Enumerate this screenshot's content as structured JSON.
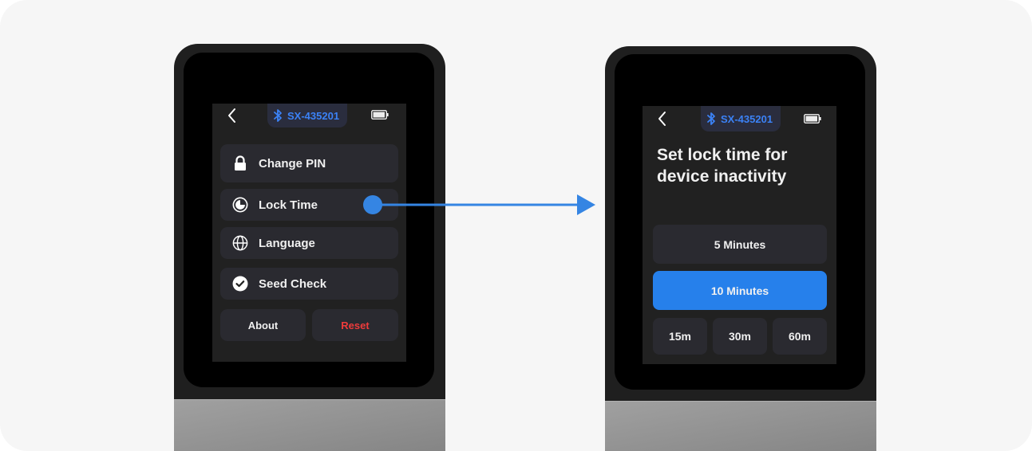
{
  "colors": {
    "accent": "#2680eb",
    "arrow": "#3585e3",
    "bluetooth_text": "#3b82f6",
    "danger": "#ef3b3b",
    "screen_bg": "#212121",
    "tile_bg": "#2a2a30"
  },
  "left_device": {
    "status": {
      "back_icon": "chevron-left-icon",
      "bluetooth_icon": "bluetooth-icon",
      "device_id": "SX-435201",
      "battery_icon": "battery-icon",
      "battery_level": 1.0
    },
    "menu": [
      {
        "icon": "lock-icon",
        "label": "Change PIN"
      },
      {
        "icon": "clock-icon",
        "label": "Lock Time"
      },
      {
        "icon": "globe-icon",
        "label": "Language"
      },
      {
        "icon": "check-circle-icon",
        "label": "Seed Check"
      }
    ],
    "bottom": {
      "about": "About",
      "reset": "Reset"
    }
  },
  "right_device": {
    "status": {
      "back_icon": "chevron-left-icon",
      "bluetooth_icon": "bluetooth-icon",
      "device_id": "SX-435201",
      "battery_icon": "battery-icon",
      "battery_level": 1.0
    },
    "title": "Set lock time for device inactivity",
    "options": {
      "five": "5 Minutes",
      "ten": "10 Minutes",
      "fifteen": "15m",
      "thirty": "30m",
      "sixty": "60m"
    },
    "selected": "10 Minutes"
  }
}
